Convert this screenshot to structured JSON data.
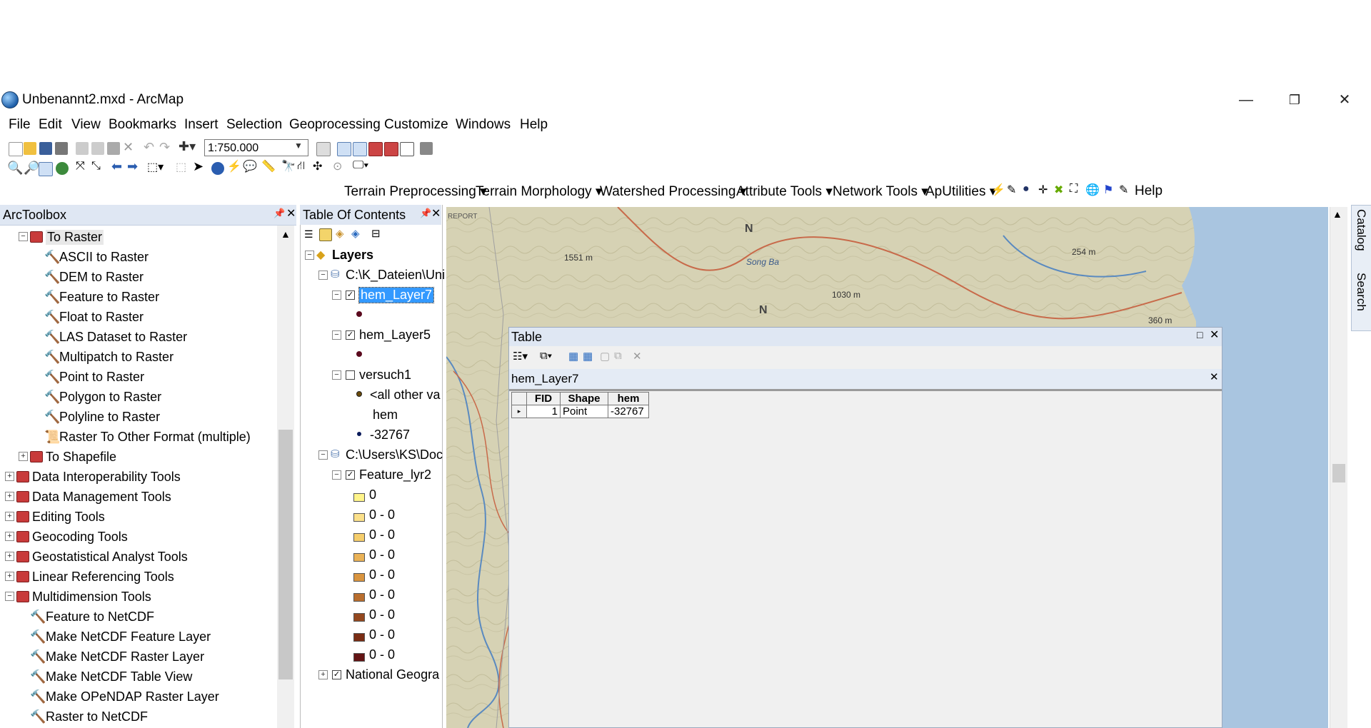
{
  "window": {
    "title": "Unbenannt2.mxd - ArcMap",
    "minimize": "—",
    "restore": "❐",
    "close": "✕"
  },
  "menu": [
    "File",
    "Edit",
    "View",
    "Bookmarks",
    "Insert",
    "Selection",
    "Geoprocessing",
    "Customize",
    "Windows",
    "Help"
  ],
  "toolbar": {
    "scale": "1:750.000"
  },
  "ext_toolbar": [
    "Terrain Preprocessing",
    "Terrain Morphology",
    "Watershed Processing",
    "Attribute Tools",
    "Network Tools",
    "ApUtilities",
    "Help"
  ],
  "arctoolbox": {
    "title": "ArcToolbox",
    "to_raster": "To Raster",
    "to_raster_tools": [
      "ASCII to Raster",
      "DEM to Raster",
      "Feature to Raster",
      "Float to Raster",
      "LAS Dataset to Raster",
      "Multipatch to Raster",
      "Point to Raster",
      "Polygon to Raster",
      "Polyline to Raster",
      "Raster To Other Format (multiple)"
    ],
    "to_shapefile": "To Shapefile",
    "toolboxes": [
      "Data Interoperability Tools",
      "Data Management Tools",
      "Editing Tools",
      "Geocoding Tools",
      "Geostatistical Analyst Tools",
      "Linear Referencing Tools",
      "Multidimension Tools"
    ],
    "multidim_tools": [
      "Feature to NetCDF",
      "Make NetCDF Feature Layer",
      "Make NetCDF Raster Layer",
      "Make NetCDF Table View",
      "Make OPeNDAP Raster Layer",
      "Raster to NetCDF"
    ]
  },
  "toc": {
    "title": "Table Of Contents",
    "layers": "Layers",
    "path1": "C:\\K_Dateien\\Uni",
    "layer1": "hem_Layer7",
    "layer2": "hem_Layer5",
    "layer3": "versuch1",
    "layer3_all": "<all other va",
    "layer3_field": "hem",
    "layer3_val": "-32767",
    "path2": "C:\\Users\\KS\\Doc",
    "layer4": "Feature_lyr2",
    "classes": [
      "0",
      "0 - 0",
      "0 - 0",
      "0 - 0",
      "0 - 0",
      "0 - 0",
      "0 - 0",
      "0 - 0",
      "0 - 0"
    ],
    "class_colors": [
      "#fff48a",
      "#fbe08a",
      "#f5cd6b",
      "#eab257",
      "#d9943f",
      "#b96e2e",
      "#94481f",
      "#7a2d14",
      "#631414"
    ],
    "basemap": "National Geogra"
  },
  "map_labels": [
    "REPORT",
    "N",
    "1551 m",
    "Song Ba",
    "1030 m",
    "N",
    "254 m",
    "360 m"
  ],
  "side_tabs": [
    "Catalog",
    "Search"
  ],
  "table": {
    "title": "Table",
    "layer": "hem_Layer7",
    "columns": [
      "FID",
      "Shape",
      "hem"
    ],
    "rows": [
      [
        "1",
        "Point",
        "-32767"
      ]
    ]
  }
}
